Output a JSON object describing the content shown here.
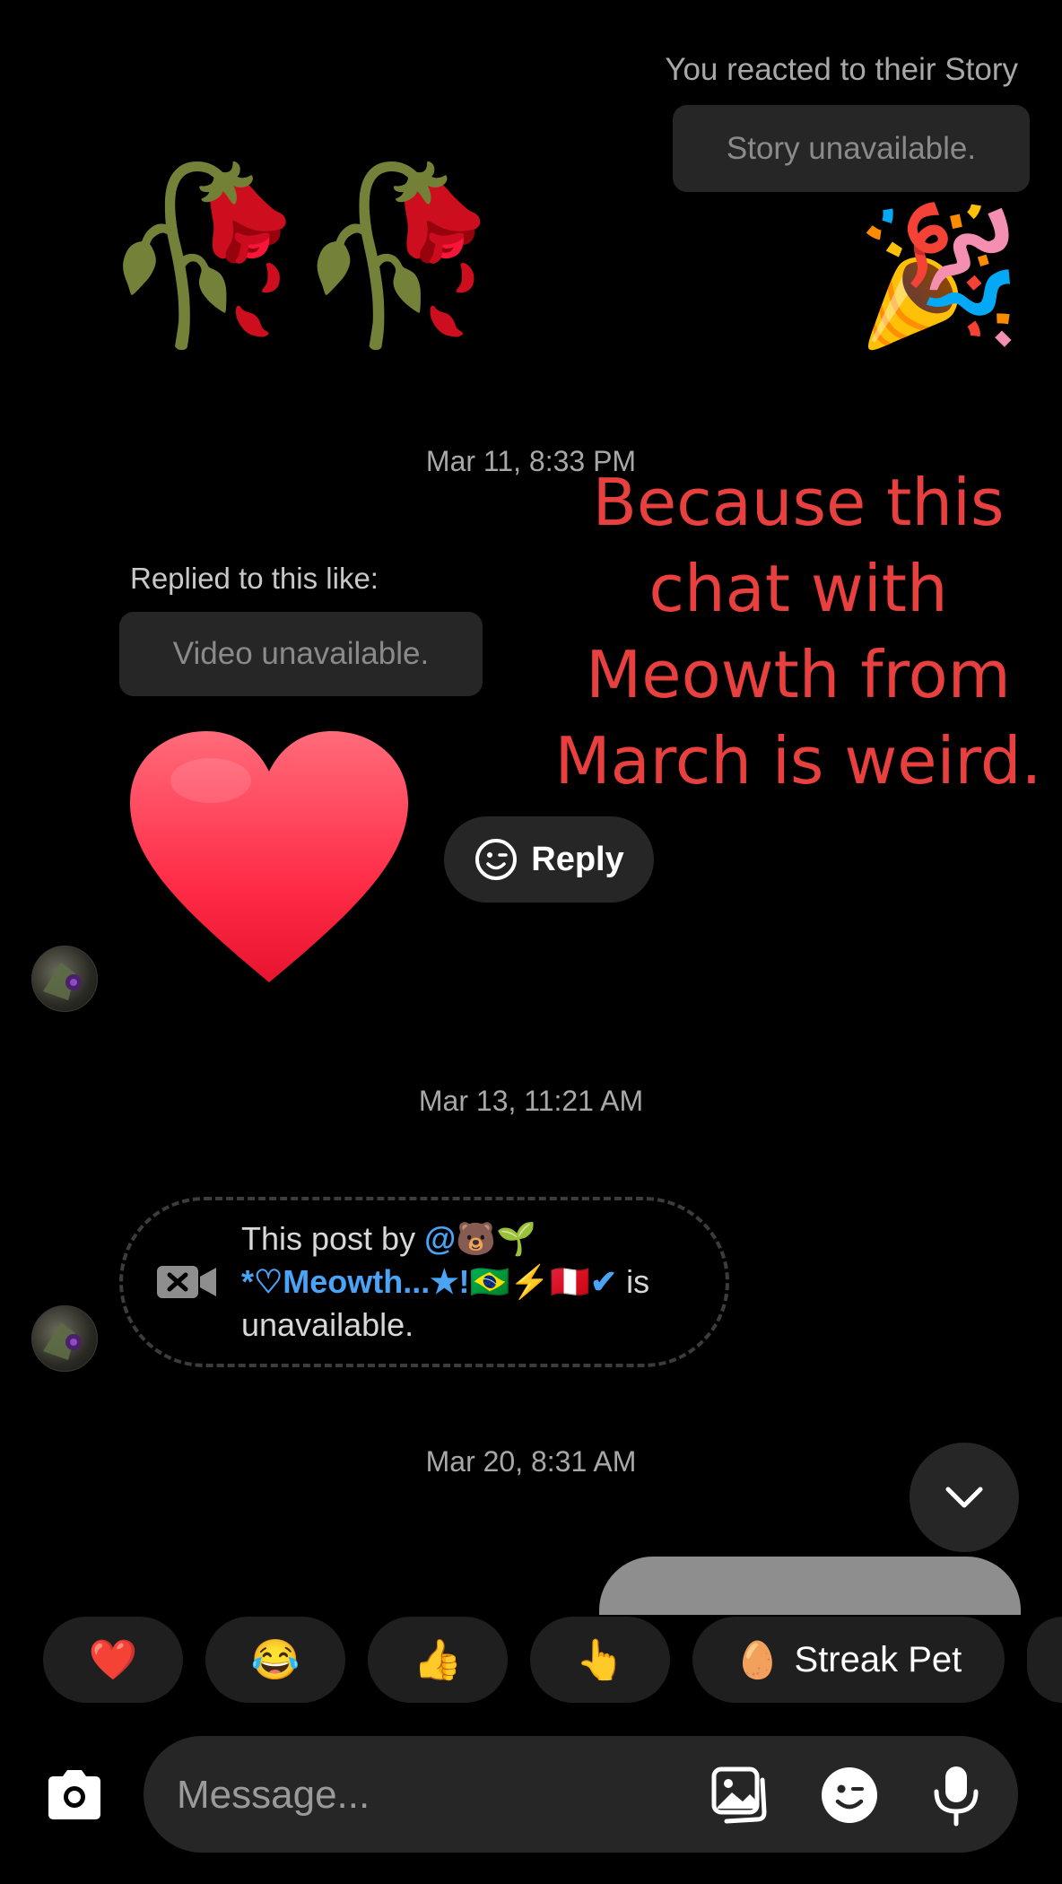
{
  "story": {
    "reacted_label": "You reacted to their Story",
    "unavailable": "Story unavailable.",
    "reaction_emoji": "🎉"
  },
  "sent_emojis": "🥀🥀",
  "timestamps": {
    "t1": "Mar 11, 8:33 PM",
    "t2": "Mar 13, 11:21 AM",
    "t3": "Mar 20, 8:31 AM"
  },
  "reply_context": {
    "label": "Replied to this like:",
    "unavailable": "Video unavailable."
  },
  "reply_button": {
    "label": "Reply"
  },
  "overlay_caption": {
    "line1": "Because this",
    "line2": "chat with",
    "line3": "Meowth from",
    "line4": "March is weird."
  },
  "unavailable_post": {
    "prefix": "This post by ",
    "handle": "@🐻🌱 *♡Meowth...★!🇧🇷⚡🇵🇪✔",
    "suffix": " is unavailable."
  },
  "quick_reactions": [
    {
      "emoji": "❤️"
    },
    {
      "emoji": "😂"
    },
    {
      "emoji": "👍"
    },
    {
      "emoji": "👆"
    },
    {
      "emoji": "🥚",
      "label": "Streak Pet"
    }
  ],
  "composer": {
    "placeholder": "Message..."
  },
  "colors": {
    "background": "#000000",
    "bubble": "#262626",
    "overlay_text": "#e8403e",
    "handle_link": "#4aa3f5"
  },
  "icons": [
    "camera-icon",
    "gallery-icon",
    "sticker-icon",
    "microphone-icon",
    "chevron-down-icon",
    "video-off-icon",
    "smiley-icon"
  ]
}
